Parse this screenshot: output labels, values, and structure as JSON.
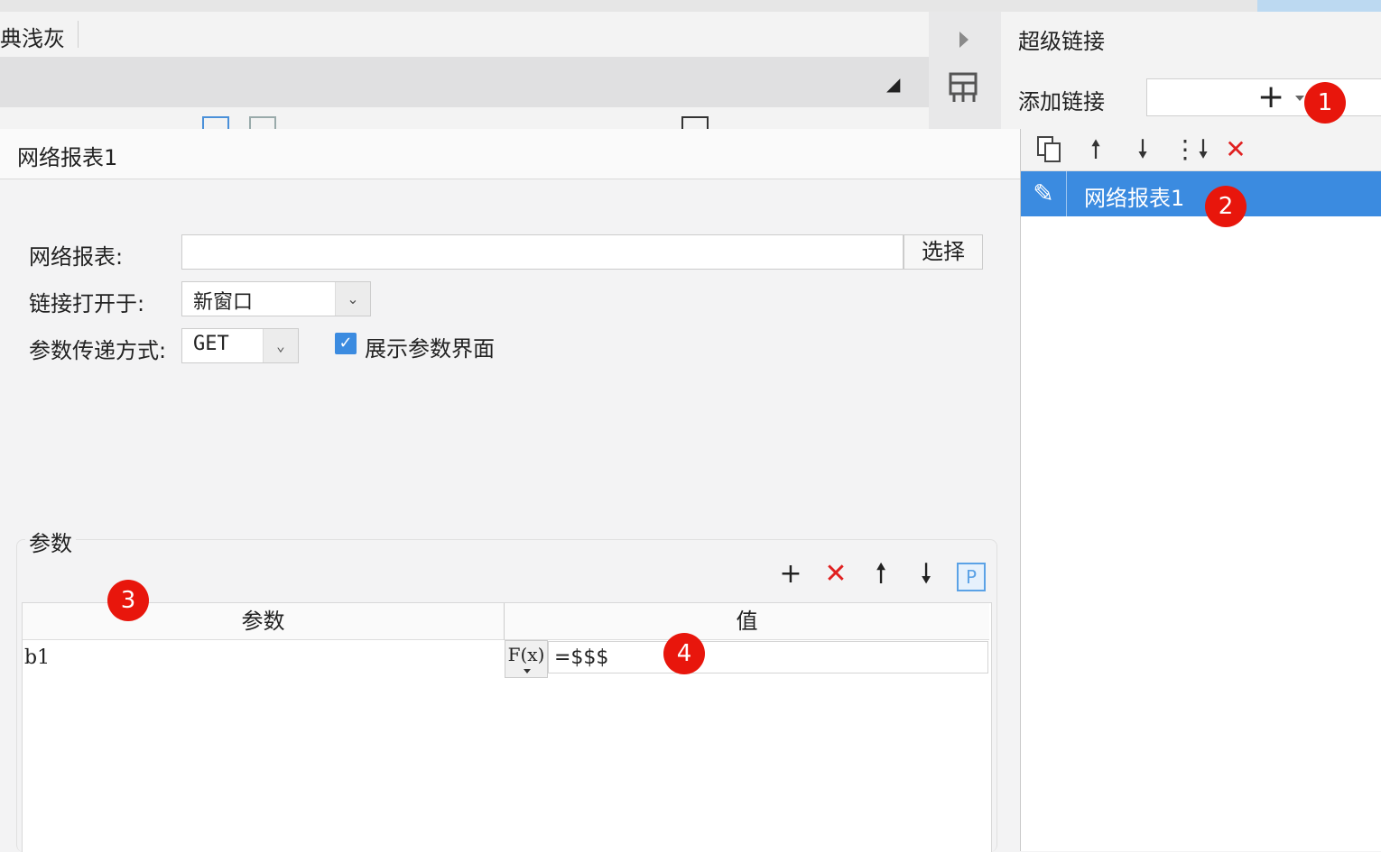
{
  "theme": {
    "label": "典浅灰"
  },
  "tab": {
    "title": "网络报表1"
  },
  "form": {
    "report_label": "网络报表:",
    "report_value": "",
    "select_button": "选择",
    "open_in_label": "链接打开于:",
    "open_in_value": "新窗口",
    "param_method_label": "参数传递方式:",
    "param_method_value": "GET",
    "show_params_label": "展示参数界面",
    "show_params_checked": true
  },
  "params": {
    "group_title": "参数",
    "columns": [
      "参数",
      "值"
    ],
    "rows": [
      {
        "name": "b1",
        "value": "=$$$"
      }
    ],
    "formula_button": "F(x)",
    "toolbar_icons": [
      "plus-icon",
      "delete-icon",
      "arrow-up-icon",
      "arrow-down-icon",
      "parameter-icon"
    ]
  },
  "right_panel": {
    "title": "超级链接",
    "add_label": "添加链接",
    "add_icon": "plus-icon",
    "toolbar_icons": [
      "copy-icon",
      "arrow-up-icon",
      "arrow-down-icon",
      "sort-icon",
      "delete-icon"
    ],
    "items": [
      {
        "label": "网络报表1",
        "icon": "pencil-icon",
        "selected": true
      }
    ]
  },
  "markers": [
    "1",
    "2",
    "3",
    "4"
  ],
  "colors": {
    "accent": "#3b8be0",
    "marker": "#e8160c",
    "delete": "#e02020"
  }
}
